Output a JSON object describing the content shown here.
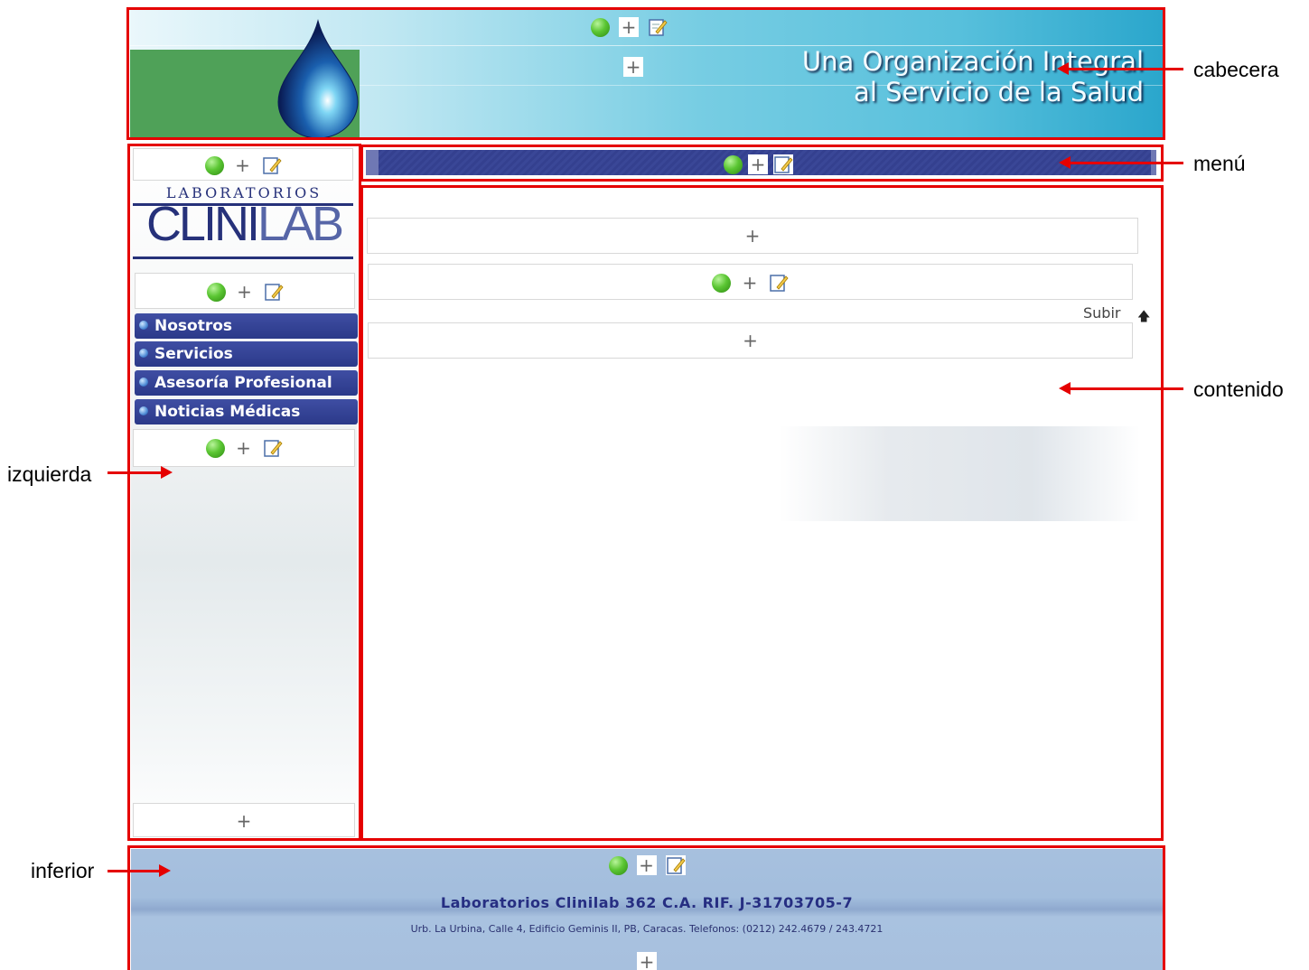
{
  "header": {
    "slogan_line1": "Una Organización Integral",
    "slogan_line2": "al Servicio de la Salud",
    "add_symbol": "+"
  },
  "left": {
    "logo_top": "LABORATORIOS",
    "logo_main_a": "CLINI",
    "logo_main_b": "LAB",
    "nav": [
      {
        "label": "Nosotros"
      },
      {
        "label": "Servicios"
      },
      {
        "label": "Asesoría Profesional"
      },
      {
        "label": "Noticias Médicas"
      }
    ],
    "add_symbol": "+"
  },
  "content": {
    "subir_label": "Subir",
    "add_symbol": "+"
  },
  "footer": {
    "title": "Laboratorios Clinilab 362 C.A. RIF. J-31703705-7",
    "address": "Urb. La Urbina, Calle 4, Edificio Geminis II, PB, Caracas. Telefonos: (0212) 242.4679 / 243.4721",
    "add_symbol": "+"
  },
  "annotations": {
    "cabecera": "cabecera",
    "menu": "menú",
    "contenido": "contenido",
    "izquierda": "izquierda",
    "inferior": "inferior"
  },
  "colors": {
    "annotation": "#e50000",
    "nav_blue": "#2b3989",
    "logo_blue": "#26317a",
    "footer_blue": "#a7c0de"
  },
  "icons": [
    "green-dot-icon",
    "plus-icon",
    "edit-icon",
    "up-arrow-icon"
  ]
}
